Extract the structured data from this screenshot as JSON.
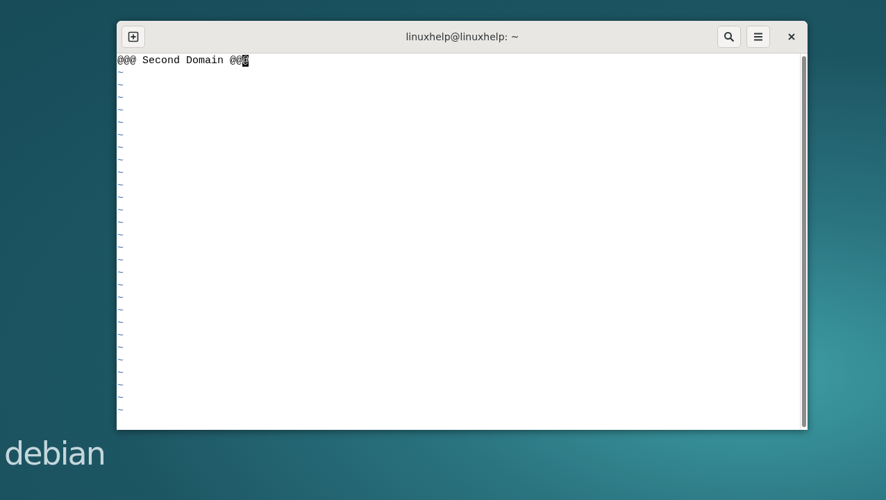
{
  "desktop": {
    "logo_text": "debian"
  },
  "window": {
    "title": "linuxhelp@linuxhelp: ~"
  },
  "editor": {
    "first_line": "@@@ Second Domain @@",
    "cursor_char": "@",
    "empty_lines": [
      "~",
      "~",
      "~",
      "~",
      "~",
      "~",
      "~",
      "~",
      "~",
      "~",
      "~",
      "~",
      "~",
      "~",
      "~",
      "~",
      "~",
      "~",
      "~",
      "~",
      "~",
      "~",
      "~",
      "~",
      "~",
      "~",
      "~",
      "~"
    ]
  }
}
